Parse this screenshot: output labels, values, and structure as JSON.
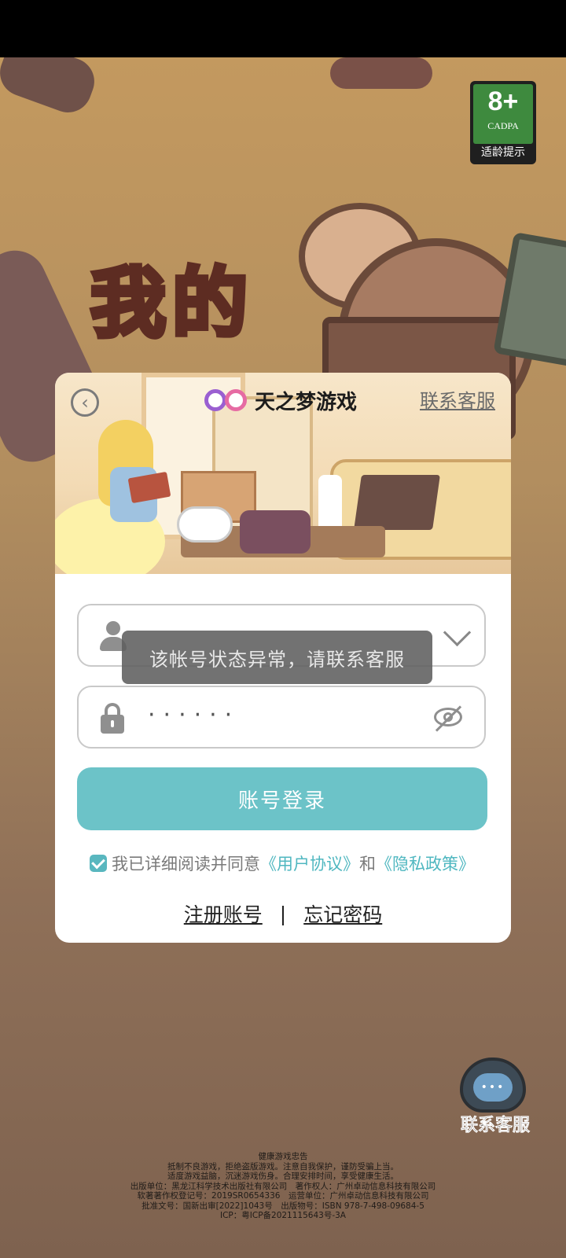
{
  "age_rating": {
    "age": "8+",
    "org": "CADPA",
    "hint": "适龄提示"
  },
  "background": {
    "game_title": "我的"
  },
  "dialog": {
    "brand_name": "天之梦游戏",
    "contact_link": "联系客服",
    "username_value": "",
    "password_value": "······",
    "toast": "该帐号状态异常，请联系客服",
    "login_button": "账号登录",
    "agreement": {
      "prefix": "我已详细阅读并同意",
      "user_agreement": "《用户协议》",
      "and": "和",
      "privacy_policy": "《隐私政策》"
    },
    "register": "注册账号",
    "separator": "|",
    "forgot": "忘记密码"
  },
  "floating_support": {
    "label": "联系客服",
    "bubble": "•••"
  },
  "footer": {
    "lines": [
      "健康游戏忠告",
      "抵制不良游戏，拒绝盗版游戏。注意自我保护，谨防受骗上当。",
      "适度游戏益脑，沉迷游戏伤身。合理安排时间，享受健康生活。",
      "出版单位：黑龙江科学技术出版社有限公司　著作权人：广州卓动信息科技有限公司",
      "软著著作权登记号：2019SR0654336　运营单位：广州卓动信息科技有限公司",
      "批准文号：国新出审[2022]1043号　出版物号：ISBN 978-7-498-09684-5",
      "ICP：粤ICP备2021115643号-3A"
    ]
  },
  "colors": {
    "accent": "#6cc3c8",
    "link": "#4fb7c0",
    "toast_bg": "#5f5f5f"
  }
}
